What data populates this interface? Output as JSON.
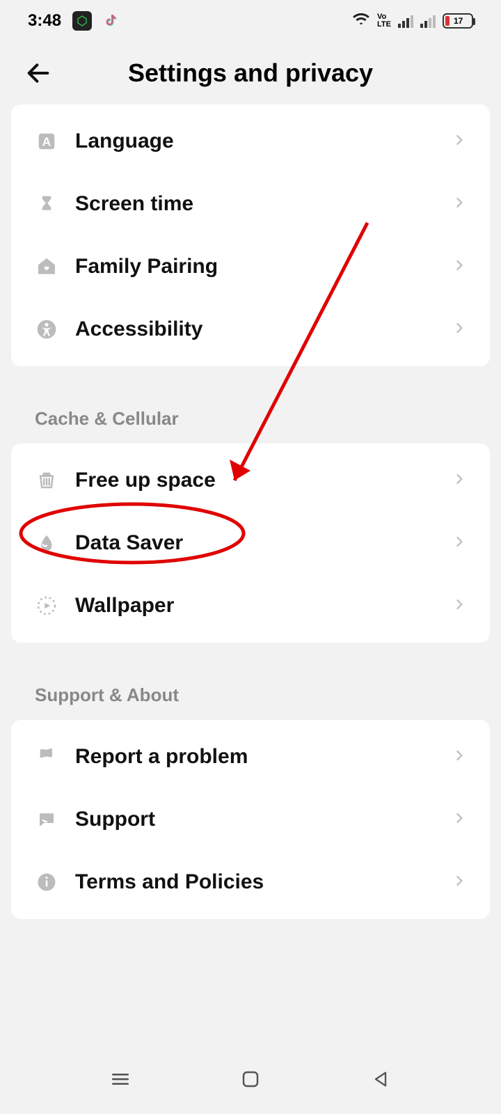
{
  "status": {
    "time": "3:48",
    "battery": "17",
    "volte": "Vo LTE"
  },
  "header": {
    "title": "Settings and privacy"
  },
  "group1": {
    "items": [
      {
        "label": "Language"
      },
      {
        "label": "Screen time"
      },
      {
        "label": "Family Pairing"
      },
      {
        "label": "Accessibility"
      }
    ]
  },
  "group2": {
    "title": "Cache & Cellular",
    "items": [
      {
        "label": "Free up space"
      },
      {
        "label": "Data Saver"
      },
      {
        "label": "Wallpaper"
      }
    ]
  },
  "group3": {
    "title": "Support & About",
    "items": [
      {
        "label": "Report a problem"
      },
      {
        "label": "Support"
      },
      {
        "label": "Terms and Policies"
      }
    ]
  },
  "annotation": {
    "highlight_color": "#e00000",
    "highlighted_item": "Free up space"
  }
}
